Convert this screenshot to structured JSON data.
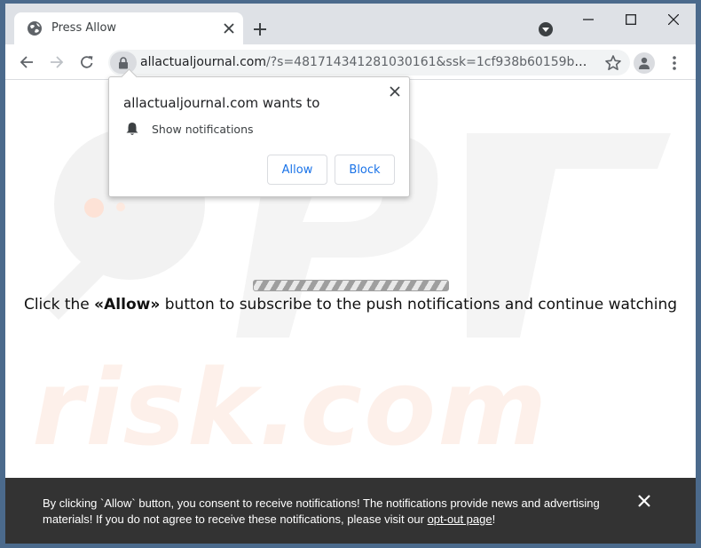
{
  "tab": {
    "title": "Press Allow"
  },
  "toolbar": {
    "url_domain": "allactualjournal.com",
    "url_path": "/?s=481714341281030161&ssk=1cf938b60159b221e4e..."
  },
  "popup": {
    "title": "allactualjournal.com wants to",
    "permission": "Show notifications",
    "allow_label": "Allow",
    "block_label": "Block"
  },
  "page": {
    "msg_prefix": "Click the ",
    "msg_bold": "«Allow»",
    "msg_suffix": " button to subscribe to the push notifications and continue watching"
  },
  "banner": {
    "text": "By clicking `Allow` button, you consent to receive notifications! The notifications provide news and advertising materials! If you do not agree to receive these notifications, please visit our ",
    "link": "opt-out page",
    "text_end": "!"
  },
  "watermark": {
    "text": "risk.com"
  },
  "colors": {
    "accent": "#1a73e8",
    "banner_bg": "#333333",
    "chrome_bg": "#dee1e6"
  },
  "icons": {
    "favicon": "globe-icon",
    "lock": "lock-icon",
    "bell": "bell-icon",
    "star": "star-icon",
    "profile": "person-icon"
  }
}
